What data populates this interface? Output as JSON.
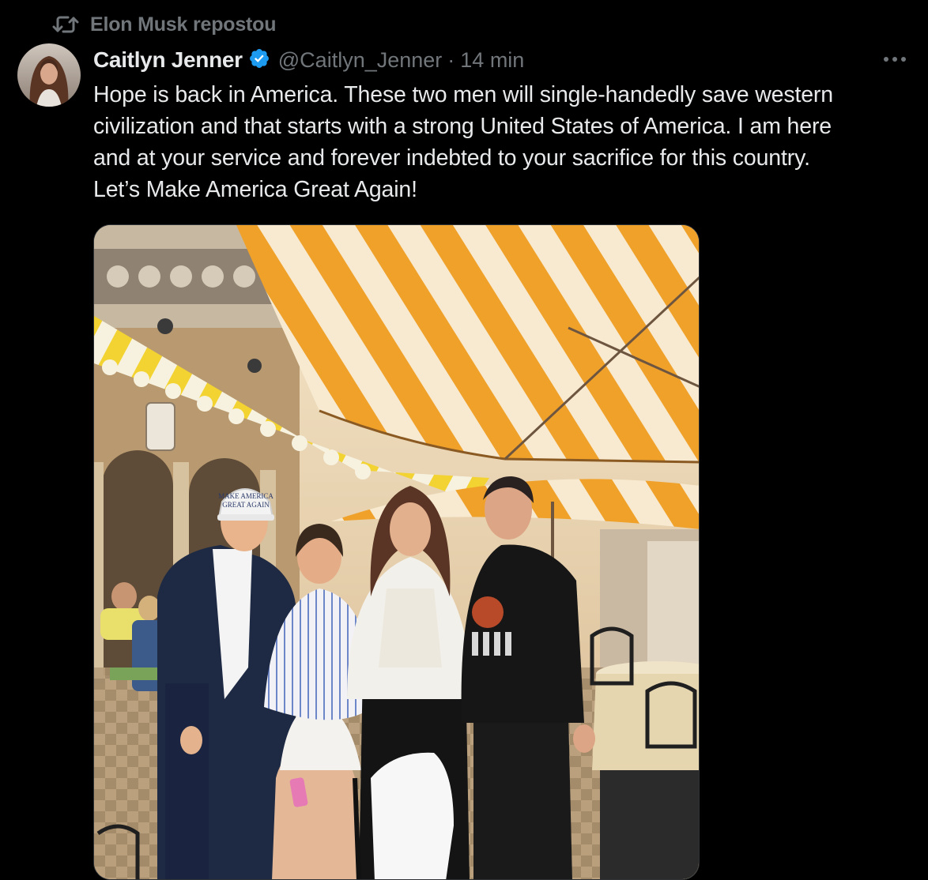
{
  "repost": {
    "text": "Elon Musk repostou",
    "icon": "repost-icon"
  },
  "author": {
    "display_name": "Caitlyn Jenner",
    "handle": "@Caitlyn_Jenner",
    "separator": "·",
    "timestamp": "14 min",
    "verified": true,
    "avatar_icon": "avatar-image"
  },
  "post": {
    "text_lines": [
      "Hope is back in America. These two men will single-handedly save western",
      "civilization and that starts with a strong United States of America. I am here",
      "and at your service and forever indebted to your sacrifice for this country.",
      "Let’s Make America Great Again!"
    ],
    "hat_text_line1": "MAKE AMERICA",
    "hat_text_line2": "GREAT AGAIN"
  },
  "more_icon": "more-dots-icon",
  "colors": {
    "background": "#000000",
    "primary_text": "#e7e9ea",
    "secondary_text": "#71767b",
    "verified_blue": "#1d9bf0",
    "awning_orange": "#f0a12a",
    "awning_cream": "#f7ead0",
    "awning_yellow": "#f2d331"
  }
}
